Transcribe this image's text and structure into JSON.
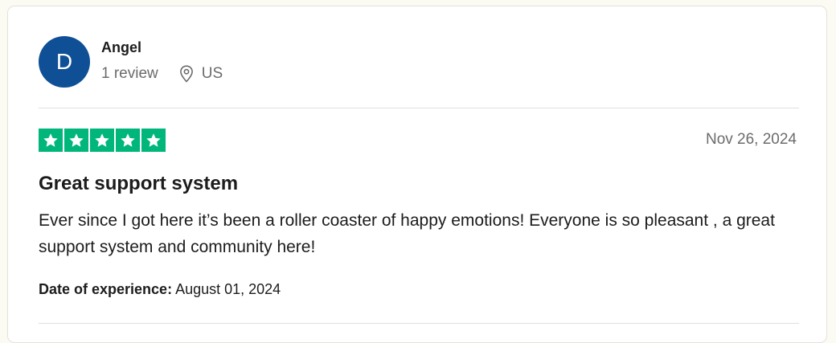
{
  "reviewer": {
    "initial": "D",
    "name": "Angel",
    "review_count": "1 review",
    "country": "US",
    "avatar_color": "#0e4f96"
  },
  "review": {
    "rating": 5,
    "max_rating": 5,
    "star_color": "#00b67a",
    "date": "Nov 26, 2024",
    "title": "Great support system",
    "body": "Ever since I got here it’s been a roller coaster of happy emotions! Everyone is so pleasant , a great support system and community here!",
    "experience_label": "Date of experience:",
    "experience_date": "August 01, 2024"
  }
}
